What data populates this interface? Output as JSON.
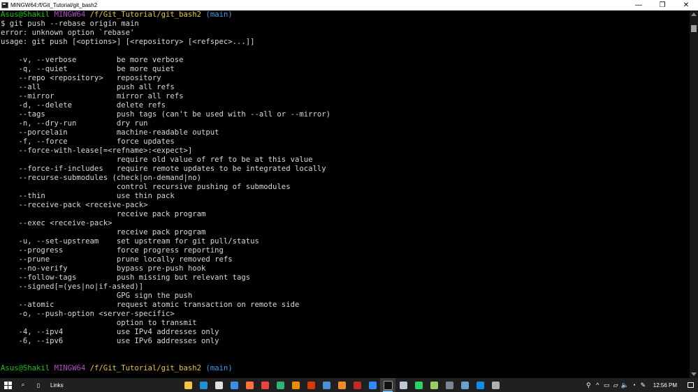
{
  "window": {
    "title": "MINGW64:/f/Git_Tutorial/git_bash2",
    "minimize_glyph": "—",
    "maximize_glyph": "❐",
    "close_glyph": "✕"
  },
  "terminal": {
    "prompt_top": {
      "user": "Asus@Shakil",
      "env": "MINGW64",
      "path": "/f/Git_Tutorial/git_bash2",
      "branch": "(main)"
    },
    "command": "$ git push --rebase origin main",
    "error": "error: unknown option `rebase'",
    "usage": "usage: git push [<options>] [<repository> [<refspec>...]]",
    "options": [
      "    -v, --verbose         be more verbose",
      "    -q, --quiet           be more quiet",
      "    --repo <repository>   repository",
      "    --all                 push all refs",
      "    --mirror              mirror all refs",
      "    -d, --delete          delete refs",
      "    --tags                push tags (can't be used with --all or --mirror)",
      "    -n, --dry-run         dry run",
      "    --porcelain           machine-readable output",
      "    -f, --force           force updates",
      "    --force-with-lease[=<refname>:<expect>]",
      "                          require old value of ref to be at this value",
      "    --force-if-includes   require remote updates to be integrated locally",
      "    --recurse-submodules (check|on-demand|no)",
      "                          control recursive pushing of submodules",
      "    --thin                use thin pack",
      "    --receive-pack <receive-pack>",
      "                          receive pack program",
      "    --exec <receive-pack>",
      "                          receive pack program",
      "    -u, --set-upstream    set upstream for git pull/status",
      "    --progress            force progress reporting",
      "    --prune               prune locally removed refs",
      "    --no-verify           bypass pre-push hook",
      "    --follow-tags         push missing but relevant tags",
      "    --signed[=(yes|no|if-asked)]",
      "                          GPG sign the push",
      "    --atomic              request atomic transaction on remote side",
      "    -o, --push-option <server-specific>",
      "                          option to transmit",
      "    -4, --ipv4            use IPv4 addresses only",
      "    -6, --ipv6            use IPv6 addresses only"
    ],
    "prompt_bottom": {
      "user": "Asus@Shakil",
      "env": "MINGW64",
      "path": "/f/Git_Tutorial/git_bash2",
      "branch": "(main)"
    }
  },
  "taskbar": {
    "links_label": "Links",
    "search_glyph": "⌕",
    "apps": [
      {
        "name": "file-explorer",
        "color": "#f4c542"
      },
      {
        "name": "edge",
        "color": "#1e90d6"
      },
      {
        "name": "store",
        "color": "#e0e0e0"
      },
      {
        "name": "mail",
        "color": "#3a8ee6"
      },
      {
        "name": "firefox",
        "color": "#ff7139"
      },
      {
        "name": "chrome",
        "color": "#e8453c"
      },
      {
        "name": "gitkraken",
        "color": "#2bb673"
      },
      {
        "name": "vlc",
        "color": "#f08a00"
      },
      {
        "name": "office",
        "color": "#d83b01"
      },
      {
        "name": "virtualbox",
        "color": "#4a90d9"
      },
      {
        "name": "sublime",
        "color": "#f28c28"
      },
      {
        "name": "filezilla",
        "color": "#c62828"
      },
      {
        "name": "zoom",
        "color": "#2d8cff"
      },
      {
        "name": "terminal",
        "color": "#111111",
        "active": true
      },
      {
        "name": "remote-desktop",
        "color": "#bfc8d6"
      },
      {
        "name": "whatsapp",
        "color": "#25d366"
      },
      {
        "name": "vpn",
        "color": "#9ccc65"
      },
      {
        "name": "calculator",
        "color": "#7a8894"
      },
      {
        "name": "steam",
        "color": "#66a3d2"
      },
      {
        "name": "teamviewer",
        "color": "#0e8ee9"
      },
      {
        "name": "notes",
        "color": "#b0b0b0"
      }
    ],
    "tray_glyphs": [
      "⚲",
      "^",
      "▭",
      "▱",
      "🔈",
      "◔",
      "✎"
    ],
    "time": "12:56 PM"
  }
}
